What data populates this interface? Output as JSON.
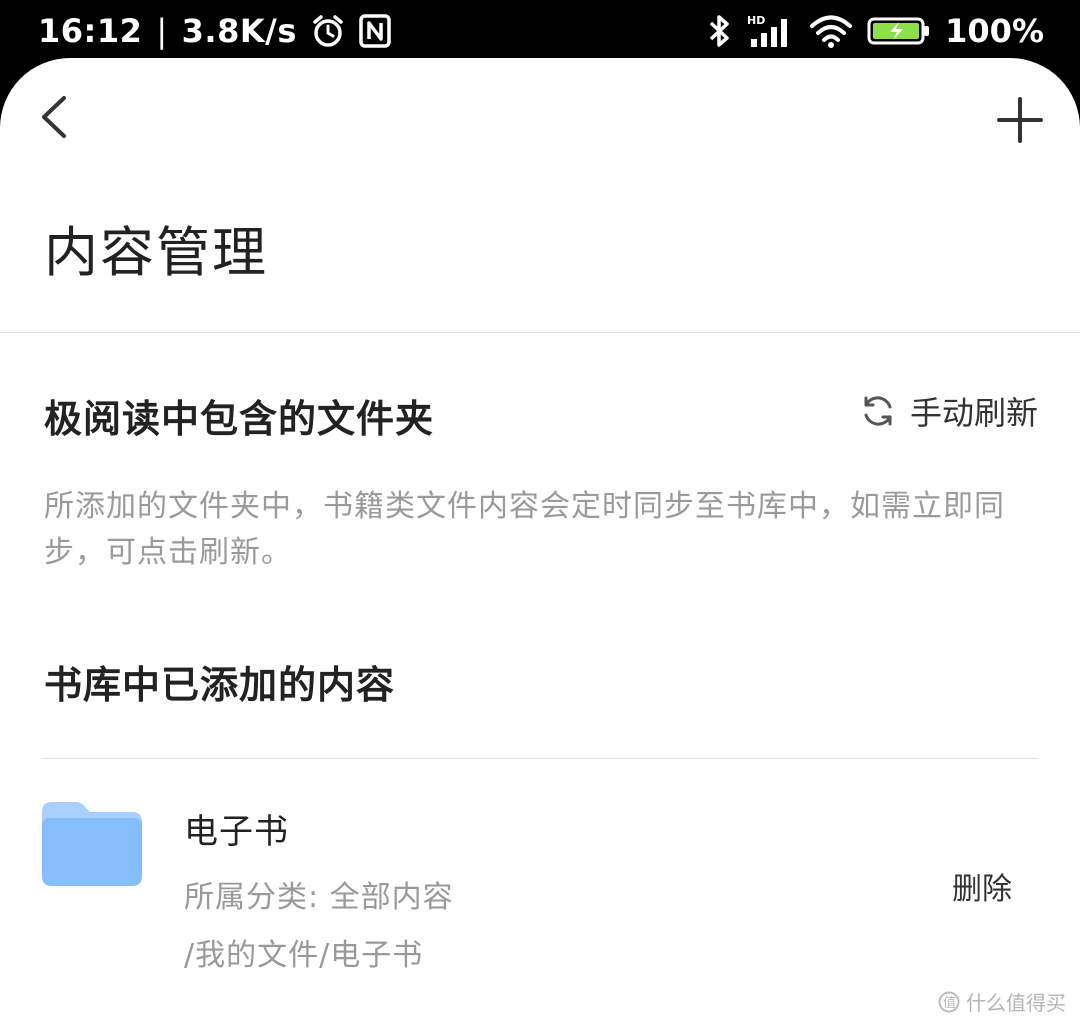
{
  "status_bar": {
    "time": "16:12",
    "separator": "|",
    "speed": "3.8K/s",
    "battery": "100%",
    "icons": [
      "alarm-icon",
      "nfc-icon",
      "bluetooth-icon",
      "hd-signal-icon",
      "wifi-icon",
      "battery-charging-icon"
    ]
  },
  "nav": {
    "back_icon": "back-chevron-icon",
    "add_icon": "plus-icon"
  },
  "page": {
    "title": "内容管理"
  },
  "section_folders": {
    "title": "极阅读中包含的文件夹",
    "refresh_label": "手动刷新",
    "refresh_icon": "refresh-icon",
    "description": "所添加的文件夹中，书籍类文件内容会定时同步至书库中，如需立即同步，可点击刷新。"
  },
  "section_library": {
    "title": "书库中已添加的内容",
    "items": [
      {
        "name": "电子书",
        "category": "所属分类: 全部内容",
        "path": "/我的文件/电子书",
        "delete_label": "删除",
        "icon": "folder-icon",
        "icon_color": "#86bdfb"
      }
    ]
  },
  "watermark": {
    "text": "什么值得买",
    "icon": "zhi-icon"
  },
  "colors": {
    "status_bg": "#000000",
    "sheet_bg": "#ffffff",
    "title_text": "#222222",
    "secondary_text": "#999999",
    "divider": "#e2e2e2",
    "battery_green": "#8ee04a"
  }
}
